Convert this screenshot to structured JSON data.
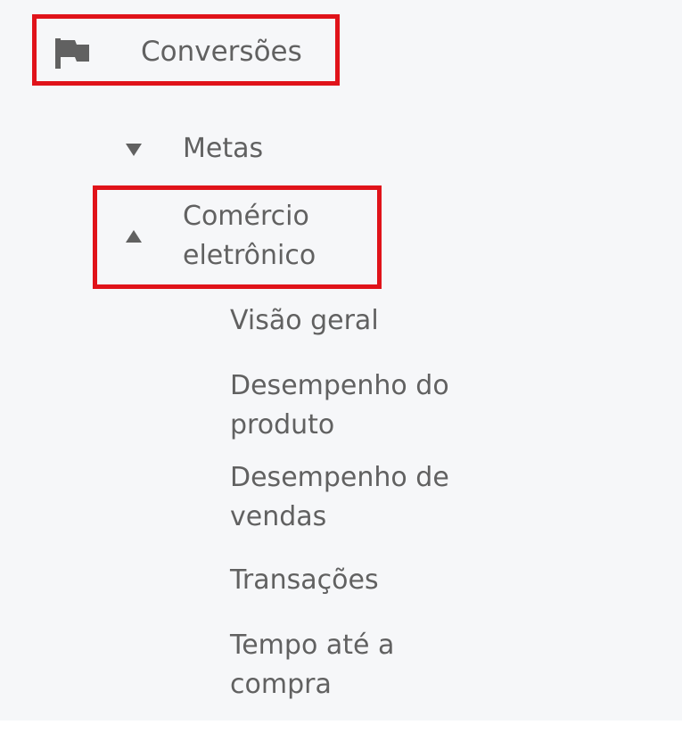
{
  "sidebar": {
    "section": {
      "label": "Conversões",
      "icon": "flag-icon"
    },
    "groups": [
      {
        "label": "Metas",
        "expanded": false,
        "icon": "triangle-down-icon"
      },
      {
        "label_line1": "Comércio",
        "label_line2": "eletrônico",
        "expanded": true,
        "icon": "triangle-up-icon"
      }
    ],
    "subitems": [
      {
        "line1": "Visão geral"
      },
      {
        "line1": "Desempenho do",
        "line2": "produto"
      },
      {
        "line1": "Desempenho de",
        "line2": "vendas"
      },
      {
        "line1": "Transações"
      },
      {
        "line1": "Tempo até a",
        "line2": "compra"
      }
    ]
  },
  "colors": {
    "background": "#f6f7f9",
    "text": "#616161",
    "highlight": "#e0131a"
  }
}
